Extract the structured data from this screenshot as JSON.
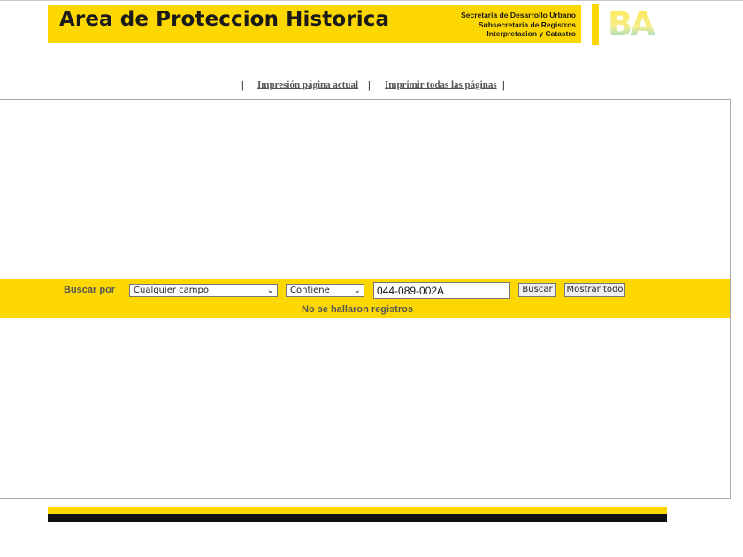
{
  "header": {
    "title": "Area de Proteccion Historica",
    "sub_lines": [
      "Secretaria de Desarrollo Urbano",
      "Subsecretaria de Registros",
      "Interpretacion y Catastro"
    ],
    "logo_text": "BA",
    "brand_yellow": "#fdd800"
  },
  "print_links": {
    "separator": "|",
    "current_page": "Impresión página actual",
    "all_pages": "Imprimir todas las páginas"
  },
  "search": {
    "label": "Buscar por",
    "field_select": "Cualquier campo",
    "operator_select": "Contiene",
    "query_value": "044-089-002A",
    "search_button": "Buscar",
    "show_all_button": "Mostrar todo",
    "status": "No se hallaron registros"
  }
}
